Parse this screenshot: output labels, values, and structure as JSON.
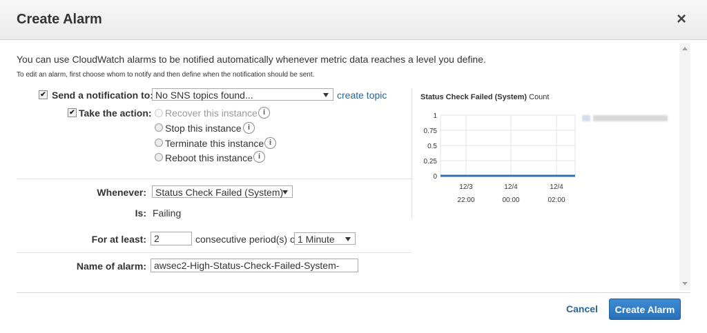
{
  "dialog": {
    "title": "Create Alarm",
    "close_glyph": "×",
    "intro": "You can use CloudWatch alarms to be notified automatically whenever metric data reaches a level you define.",
    "subintro": "To edit an alarm, first choose whom to notify and then define when the notification should be sent."
  },
  "notification": {
    "checked": true,
    "label": "Send a notification to:",
    "select_value": "No SNS topics found...",
    "link": "create topic"
  },
  "action": {
    "checked": true,
    "label": "Take the action:",
    "options": [
      {
        "label": "Recover this instance",
        "disabled": true
      },
      {
        "label": "Stop this instance",
        "disabled": false
      },
      {
        "label": "Terminate this instance",
        "disabled": false
      },
      {
        "label": "Reboot this instance",
        "disabled": false
      }
    ],
    "info_glyph": "i"
  },
  "whenever": {
    "label": "Whenever:",
    "select_value": "Status Check Failed (System)"
  },
  "is": {
    "label": "Is:",
    "value": "Failing"
  },
  "for_at_least": {
    "label": "For at least:",
    "periods": "2",
    "middle_text": "consecutive period(s) of",
    "period_select": "1 Minute"
  },
  "alarm_name": {
    "label": "Name of alarm:",
    "value": "awsec2-High-Status-Check-Failed-System-"
  },
  "chart_data": {
    "type": "line",
    "title": "Status Check Failed (System)",
    "unit": "Count",
    "ylim": [
      0,
      1
    ],
    "yticks": [
      "1",
      "0.75",
      "0.5",
      "0.25",
      "0"
    ],
    "xticks": [
      {
        "date": "12/3",
        "time": "22:00"
      },
      {
        "date": "12/4",
        "time": "00:00"
      },
      {
        "date": "12/4",
        "time": "02:00"
      }
    ],
    "series": [
      {
        "values": [
          0,
          0
        ],
        "color": "#2f6eb5"
      }
    ],
    "grid": true,
    "legend": "right (blurred)"
  },
  "footer": {
    "cancel": "Cancel",
    "create": "Create Alarm"
  },
  "colors": {
    "accent": "#2770b8",
    "link": "#2a6496"
  }
}
